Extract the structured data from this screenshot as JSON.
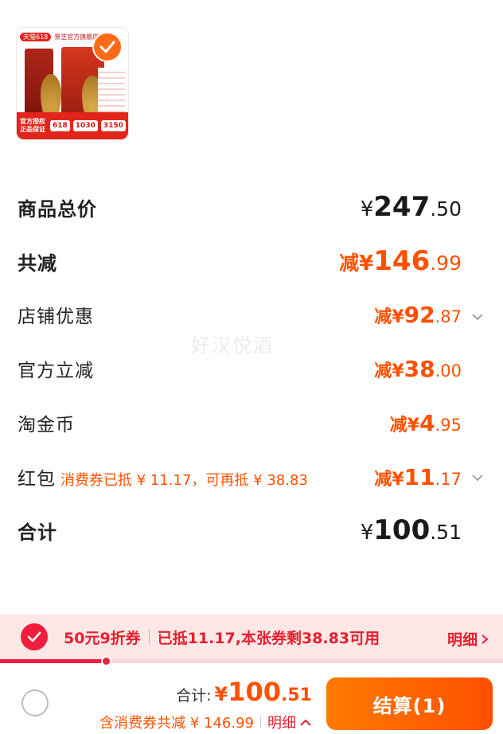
{
  "product": {
    "thumb_badge": "天猫618",
    "thumb_shop": "景芝官方旗舰店",
    "thumb_guarantee": "官方授权 正品保证",
    "thumb_coupons": [
      "618",
      "1030",
      "3150"
    ]
  },
  "price_rows": [
    {
      "label": "商品总价",
      "prefix": "",
      "currency": "¥",
      "int": "247",
      "dec": ".50"
    },
    {
      "label": "共减",
      "prefix": "减",
      "currency": "¥",
      "int": "146",
      "dec": ".99"
    },
    {
      "label": "店铺优惠",
      "prefix": "减",
      "currency": "¥",
      "int": "92",
      "dec": ".87"
    },
    {
      "label": "官方立减",
      "prefix": "减",
      "currency": "¥",
      "int": "38",
      "dec": ".00"
    },
    {
      "label": "淘金币",
      "prefix": "减",
      "currency": "¥",
      "int": "4",
      "dec": ".95"
    },
    {
      "label": "红包",
      "note": "消费券已抵 ¥ 11.17，可再抵 ¥ 38.83",
      "prefix": "减",
      "currency": "¥",
      "int": "11",
      "dec": ".17"
    },
    {
      "label": "合计",
      "prefix": "",
      "currency": "¥",
      "int": "100",
      "dec": ".51"
    }
  ],
  "watermark": "好汉悦酒",
  "coupon_bar": {
    "name": "50元9折券",
    "desc": "已抵11.17,本张券剩38.83可用",
    "detail": "明细",
    "progress": 0.21
  },
  "footer": {
    "total_label": "合计:",
    "total_currency": "¥",
    "total_int": "100",
    "total_dec": ".51",
    "discount_text": "含消费券共减 ¥ 146.99",
    "detail_label": "明细",
    "checkout_label": "结算(1)"
  },
  "colors": {
    "accent": "#ff5000",
    "coupon_red": "#e4202f",
    "coupon_bg": "#fde7e7"
  }
}
